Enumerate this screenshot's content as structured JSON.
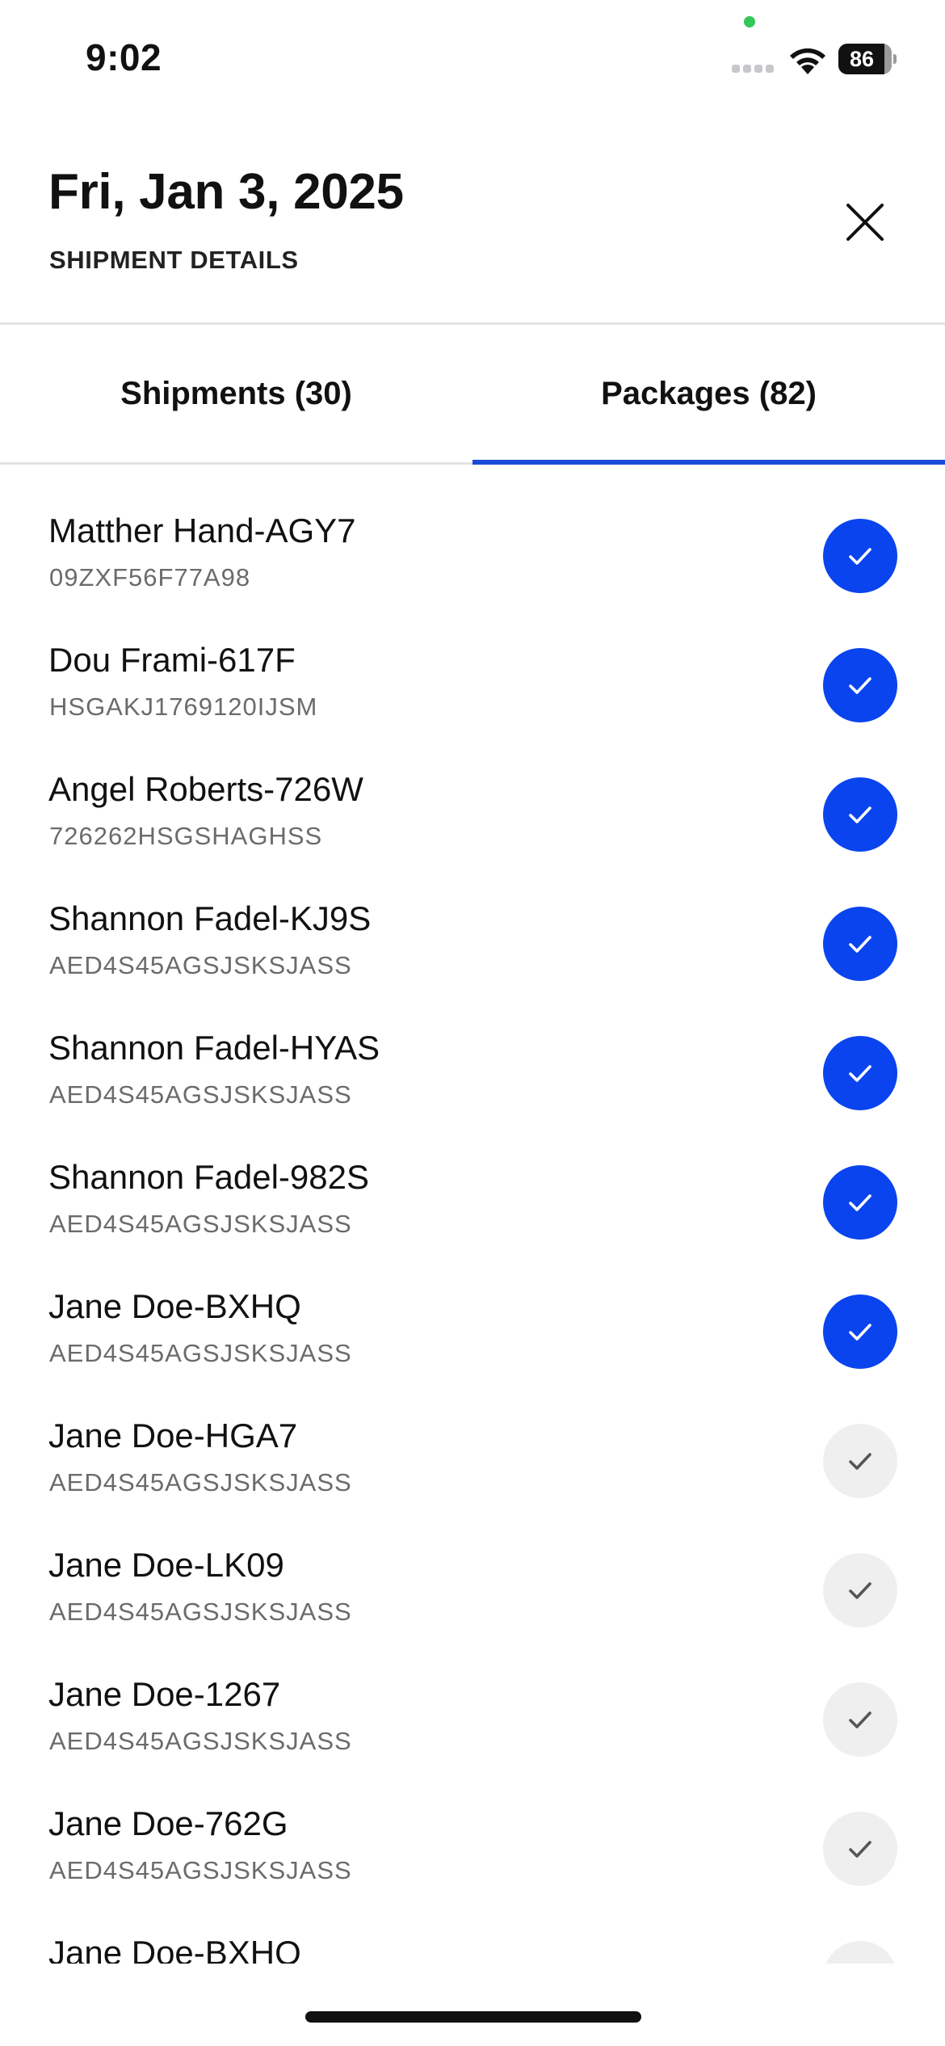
{
  "status_bar": {
    "time": "9:02",
    "battery_percent": "86",
    "battery_level": 0.86,
    "icons": [
      "signal-icon",
      "wifi-icon",
      "battery-icon"
    ]
  },
  "header": {
    "title": "Fri, Jan 3, 2025",
    "subtitle": "SHIPMENT DETAILS",
    "close_icon": "close-icon"
  },
  "tabs": [
    {
      "label": "Shipments (30)",
      "active": false
    },
    {
      "label": "Packages (82)",
      "active": true
    }
  ],
  "colors": {
    "accent": "#1a4ad8",
    "check_done": "#0a44ee",
    "check_pending": "#efefef",
    "code_text": "#6b6b6b"
  },
  "packages": [
    {
      "name": "Matther Hand-AGY7",
      "code": "09ZXF56F77A98",
      "checked": true
    },
    {
      "name": "Dou Frami-617F",
      "code": "HSGAKJ1769120IJSM",
      "checked": true
    },
    {
      "name": "Angel Roberts-726W",
      "code": "726262HSGSHAGHSS",
      "checked": true
    },
    {
      "name": "Shannon Fadel-KJ9S",
      "code": "AED4S45AGSJSKSJASS",
      "checked": true
    },
    {
      "name": "Shannon Fadel-HYAS",
      "code": "AED4S45AGSJSKSJASS",
      "checked": true
    },
    {
      "name": "Shannon Fadel-982S",
      "code": "AED4S45AGSJSKSJASS",
      "checked": true
    },
    {
      "name": "Jane Doe-BXHQ",
      "code": "AED4S45AGSJSKSJASS",
      "checked": true
    },
    {
      "name": "Jane Doe-HGA7",
      "code": "AED4S45AGSJSKSJASS",
      "checked": false
    },
    {
      "name": "Jane Doe-LK09",
      "code": "AED4S45AGSJSKSJASS",
      "checked": false
    },
    {
      "name": "Jane Doe-1267",
      "code": "AED4S45AGSJSKSJASS",
      "checked": false
    },
    {
      "name": "Jane Doe-762G",
      "code": "AED4S45AGSJSKSJASS",
      "checked": false
    },
    {
      "name": "Jane Doe-BXHQ",
      "code": "",
      "checked": false
    }
  ]
}
